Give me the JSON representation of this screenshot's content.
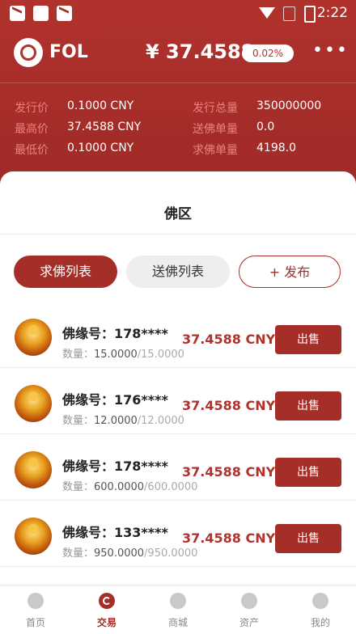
{
  "status_bar": {
    "time": "2:22"
  },
  "header": {
    "coin": "FOL",
    "price": "¥ 37.4588",
    "change": "0.02%",
    "more_icon": "more-dots-icon"
  },
  "stats": [
    {
      "label": "发行价",
      "value": "0.1000 CNY"
    },
    {
      "label": "最高价",
      "value": "37.4588 CNY"
    },
    {
      "label": "最低价",
      "value": "0.1000 CNY"
    },
    {
      "label": "发行总量",
      "value": "350000000"
    },
    {
      "label": "送佛单量",
      "value": "0.0"
    },
    {
      "label": "求佛单量",
      "value": "4198.0"
    }
  ],
  "panel": {
    "title": "佛区",
    "tabs": {
      "active": "求佛列表",
      "inactive": "送佛列表",
      "publish": "+ 发布"
    }
  },
  "list": [
    {
      "uid": "佛缘号：178****",
      "qty_label": "数量：",
      "qty_cur": "15.0000",
      "qty_total": "/15.0000",
      "price": "37.4588 CNY",
      "action": "出售"
    },
    {
      "uid": "佛缘号：176****",
      "qty_label": "数量：",
      "qty_cur": "12.0000",
      "qty_total": "/12.0000",
      "price": "37.4588 CNY",
      "action": "出售"
    },
    {
      "uid": "佛缘号：178****",
      "qty_label": "数量：",
      "qty_cur": "600.0000",
      "qty_total": "/600.0000",
      "price": "37.4588 CNY",
      "action": "出售"
    },
    {
      "uid": "佛缘号：133****",
      "qty_label": "数量：",
      "qty_cur": "950.0000",
      "qty_total": "/950.0000",
      "price": "37.4588 CNY",
      "action": "出售"
    }
  ],
  "tabbar": [
    {
      "label": "首页",
      "icon": "home-icon"
    },
    {
      "label": "交易",
      "icon": "trade-icon",
      "active": true
    },
    {
      "label": "商城",
      "icon": "mall-icon"
    },
    {
      "label": "资产",
      "icon": "assets-icon"
    },
    {
      "label": "我的",
      "icon": "profile-icon"
    }
  ],
  "colors": {
    "brand": "#a62e29",
    "header": "#b0322d"
  }
}
